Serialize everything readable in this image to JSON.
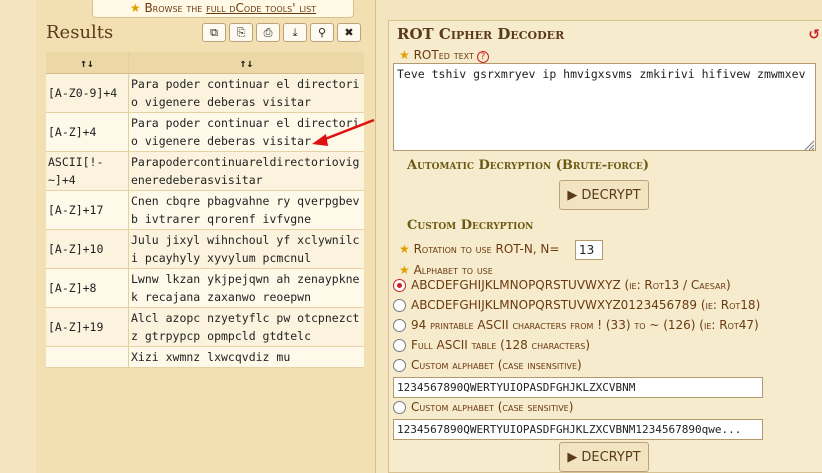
{
  "browse": {
    "star": "★",
    "prefix": "Browse the ",
    "link": "full dCode tools' list"
  },
  "results": {
    "title": "Results",
    "toolbar": [
      "⧉",
      "⎘",
      "⎙",
      "⤓",
      "⚲",
      "✖"
    ],
    "header": {
      "col1": "↑↓",
      "col2": "↑↓"
    },
    "rows": [
      {
        "key": "[A-Z0-9]+4",
        "text": "Para poder continuar el directorio vigenere deberas visitar"
      },
      {
        "key": "[A-Z]+4",
        "text": "Para poder continuar el directorio vigenere deberas visitar"
      },
      {
        "key": "ASCII[!-~]+4",
        "text": "Parapodercontinuareldirectoriovigeneredeberasvisitar"
      },
      {
        "key": "[A-Z]+17",
        "text": "Cnen cbqre pbagvahne ry qverpgbevb ivtrarer qrorenf ivfvgne"
      },
      {
        "key": "[A-Z]+10",
        "text": "Julu jixyl wihnchoul yf xclywnilci pcayhyly xyvylum pcmcnul"
      },
      {
        "key": "[A-Z]+8",
        "text": "Lwnw lkzan ykjpejqwn ah zenaypknek recajana zaxanwo reoepwn"
      },
      {
        "key": "[A-Z]+19",
        "text": "Alcl azopc nzyetyflc pw otcpnezctz gtrpypcp opmpcld gtdtelc"
      },
      {
        "key": "",
        "text": "Xizi xwmnz lxwcqvdiz mu"
      }
    ]
  },
  "decoder": {
    "title": "ROT Cipher Decoder",
    "refresh": "↺",
    "rot_label": "ROTed text",
    "rot_value": "Teve tshiv gsrxmryev ip hmvigxsvms zmkirivi hifivew zmwmxev",
    "auto_title": "Automatic Decryption (Brute-force)",
    "decrypt_label": "DECRYPT",
    "custom_title": "Custom Decryption",
    "rotation_label": "Rotation to use ROT-N, N=",
    "rotation_value": "13",
    "alphabet_label": "Alphabet to use",
    "options": [
      "ABCDEFGHIJKLMNOPQRSTUVWXYZ (ie: Rot13 / Caesar)",
      "ABCDEFGHIJKLMNOPQRSTUVWXYZ0123456789 (ie: Rot18)",
      "94 printable ASCII characters from ! (33) to ~ (126) (ie: Rot47)",
      "Full ASCII table (128 characters)",
      "Custom alphabet (case insensitive)",
      "Custom alphabet (case sensitive)"
    ],
    "custom_insensitive_value": "1234567890QWERTYUIOPASDFGHJKLZXCVBNM",
    "custom_sensitive_value": "1234567890QWERTYUIOPASDFGHJKLZXCVBNM1234567890qwe..."
  },
  "colors": {
    "accent": "#cc2222",
    "panel": "#f7ebcd",
    "background": "#f4e4bf"
  }
}
